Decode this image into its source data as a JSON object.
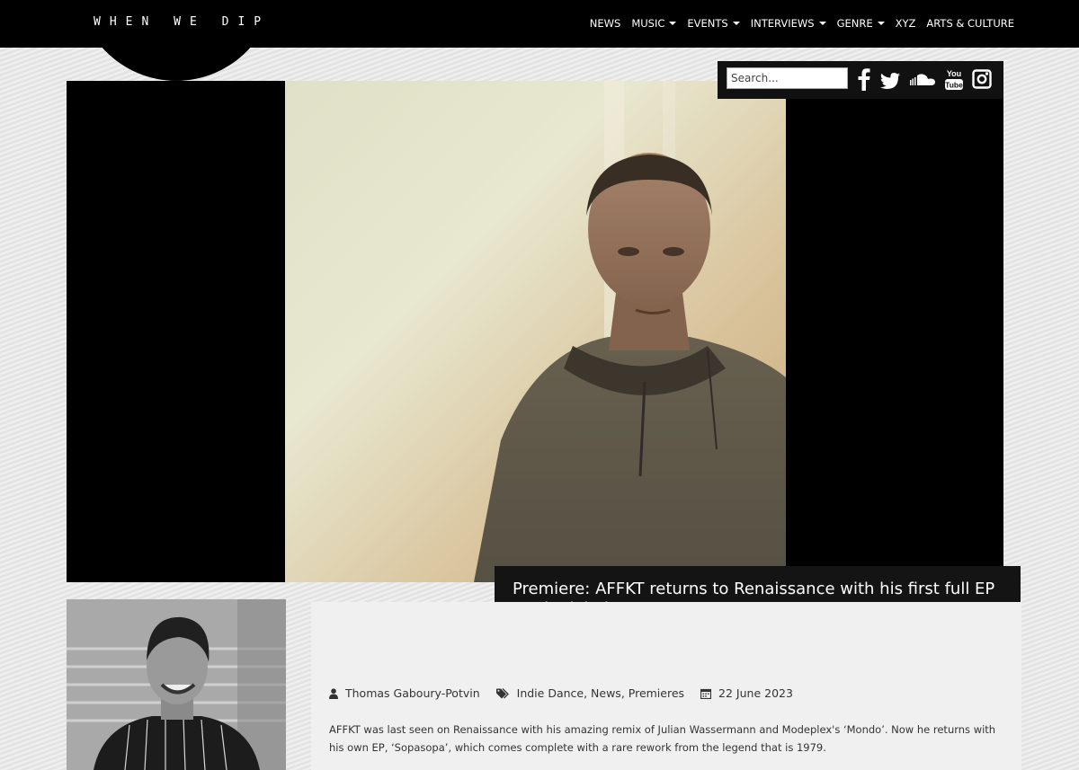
{
  "site": {
    "logo": "WHEN WE DIP"
  },
  "nav": {
    "items": [
      {
        "label": "NEWS",
        "dropdown": false
      },
      {
        "label": "MUSIC",
        "dropdown": true
      },
      {
        "label": "EVENTS",
        "dropdown": true
      },
      {
        "label": "INTERVIEWS",
        "dropdown": true
      },
      {
        "label": "GENRE",
        "dropdown": true
      },
      {
        "label": "XYZ",
        "dropdown": false
      },
      {
        "label": "ARTS & CULTURE",
        "dropdown": false
      }
    ]
  },
  "search": {
    "placeholder": "Search..."
  },
  "social": {
    "icons": [
      "facebook-icon",
      "twitter-icon",
      "soundcloud-icon",
      "youtube-icon",
      "instagram-icon"
    ]
  },
  "article": {
    "title": "Premiere: AFFKT returns to Renaissance with his first full EP on the label",
    "author": "Thomas Gaboury-Potvin",
    "tags": "Indie Dance, News, Premieres",
    "date": "22 June 2023",
    "excerpt": "AFFKT was last seen on Renaissance with his amazing remix of Julian Wassermann and Modeplex's ‘Mondo’. Now he returns with his own EP, ‘Sopasopa’, which comes complete with a rare rework from the legend that is 1979."
  },
  "colors": {
    "topbar": "#000000",
    "title_box": "#141414",
    "page_bg": "#e7e7e7"
  }
}
